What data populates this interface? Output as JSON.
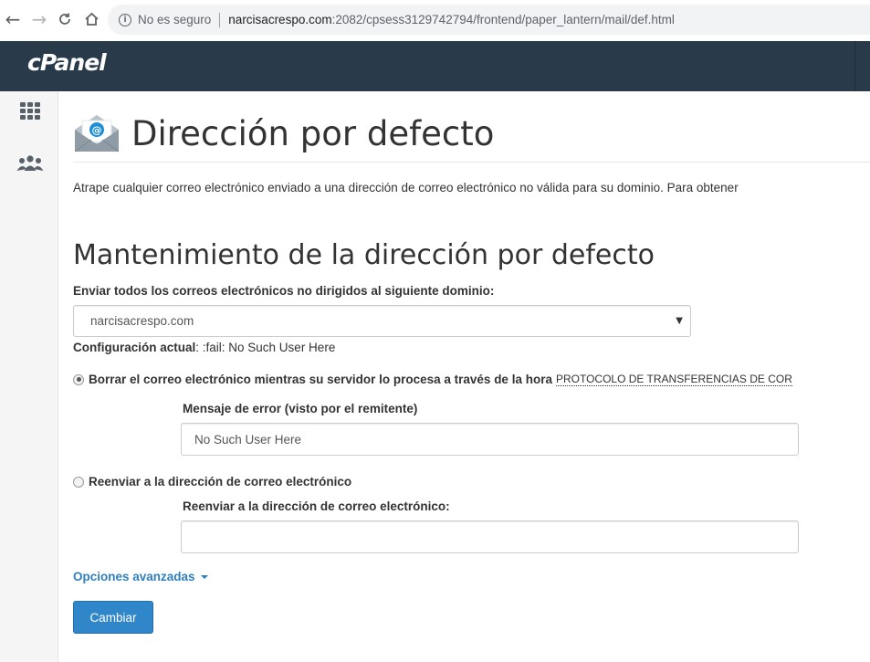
{
  "browser": {
    "security_text": "No es seguro",
    "url_host": "narcisacrespo.com",
    "url_path": ":2082/cpsess3129742794/frontend/paper_lantern/mail/def.html"
  },
  "header": {
    "logo": "cPanel",
    "bg_color": "#293a4a"
  },
  "sidebar": {
    "items": [
      {
        "icon": "grid-icon"
      },
      {
        "icon": "users-icon"
      }
    ]
  },
  "page": {
    "title": "Dirección por defecto",
    "description": "Atrape cualquier correo electrónico enviado a una dirección de correo electrónico no válida para su dominio. Para obtener"
  },
  "maintenance": {
    "title": "Mantenimiento de la dirección por defecto",
    "domain_label": "Enviar todos los correos electrónicos no dirigidos al siguiente dominio:",
    "domain_selected": "narcisacrespo.com",
    "current_label": "Configuración actual",
    "current_value": ": :fail: No Such User Here"
  },
  "options": {
    "discard": {
      "label": "Borrar el correo electrónico mientras su servidor lo procesa a través de la hora",
      "abbr": "PROTOCOLO DE TRANSFERENCIAS DE COR",
      "checked": true,
      "error_label": "Mensaje de error (visto por el remitente)",
      "error_value": "No Such User Here"
    },
    "forward": {
      "label": "Reenviar a la dirección de correo electrónico",
      "checked": false,
      "address_label": "Reenviar a la dirección de correo electrónico:",
      "address_value": ""
    }
  },
  "advanced_label": "Opciones avanzadas",
  "submit_label": "Cambiar",
  "colors": {
    "accent": "#2f86c8",
    "link": "#2f7fbf"
  }
}
